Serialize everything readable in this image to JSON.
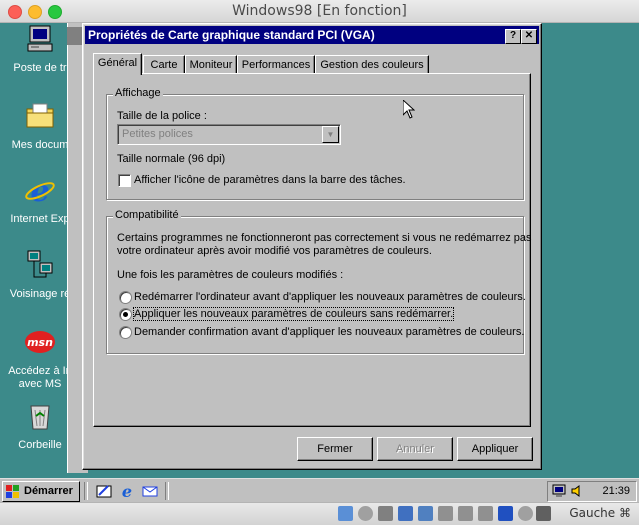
{
  "host": {
    "title": "Windows98 [En fonction]",
    "host_key": "Gauche ⌘"
  },
  "desktop": {
    "icons": [
      {
        "label": "Poste de tr"
      },
      {
        "label": "Mes docum"
      },
      {
        "label": "Internet Exp"
      },
      {
        "label": "Voisinage ré"
      },
      {
        "label": "Accédez à In avec MS"
      },
      {
        "label": "Corbeille"
      }
    ]
  },
  "dialog": {
    "title": "Propriétés de Carte graphique standard PCI (VGA)",
    "help_btn": "?",
    "close_btn": "✕",
    "tabs": [
      {
        "label": "Général"
      },
      {
        "label": "Carte"
      },
      {
        "label": "Moniteur"
      },
      {
        "label": "Performances"
      },
      {
        "label": "Gestion des couleurs"
      }
    ],
    "display_group": {
      "legend": "Affichage",
      "font_size_label": "Taille de la police :",
      "font_size_value": "Petites polices",
      "font_size_note": "Taille normale (96 dpi)",
      "show_icon_label": "Afficher l'icône de paramètres dans la barre des tâches."
    },
    "compat_group": {
      "legend": "Compatibilité",
      "description_line1": "Certains programmes ne fonctionneront pas correctement si vous ne redémarrez pas",
      "description_line2": "votre ordinateur après avoir modifié vos paramètres de couleurs.",
      "prompt": "Une fois les paramètres de couleurs modifiés :",
      "options": [
        {
          "label": "Redémarrer l'ordinateur avant d'appliquer les nouveaux paramètres de couleurs."
        },
        {
          "label": "Appliquer les nouveaux paramètres de couleurs sans redémarrer."
        },
        {
          "label": "Demander confirmation avant d'appliquer les nouveaux paramètres de couleurs."
        }
      ],
      "selected_index": 1
    },
    "buttons": {
      "close": "Fermer",
      "cancel": "Annuler",
      "apply": "Appliquer"
    }
  },
  "taskbar": {
    "start_label": "Démarrer",
    "clock": "21:39"
  },
  "colors": {
    "desktop": "#3c8a8a",
    "title_active": "#000080",
    "face": "#c0c0c0"
  }
}
